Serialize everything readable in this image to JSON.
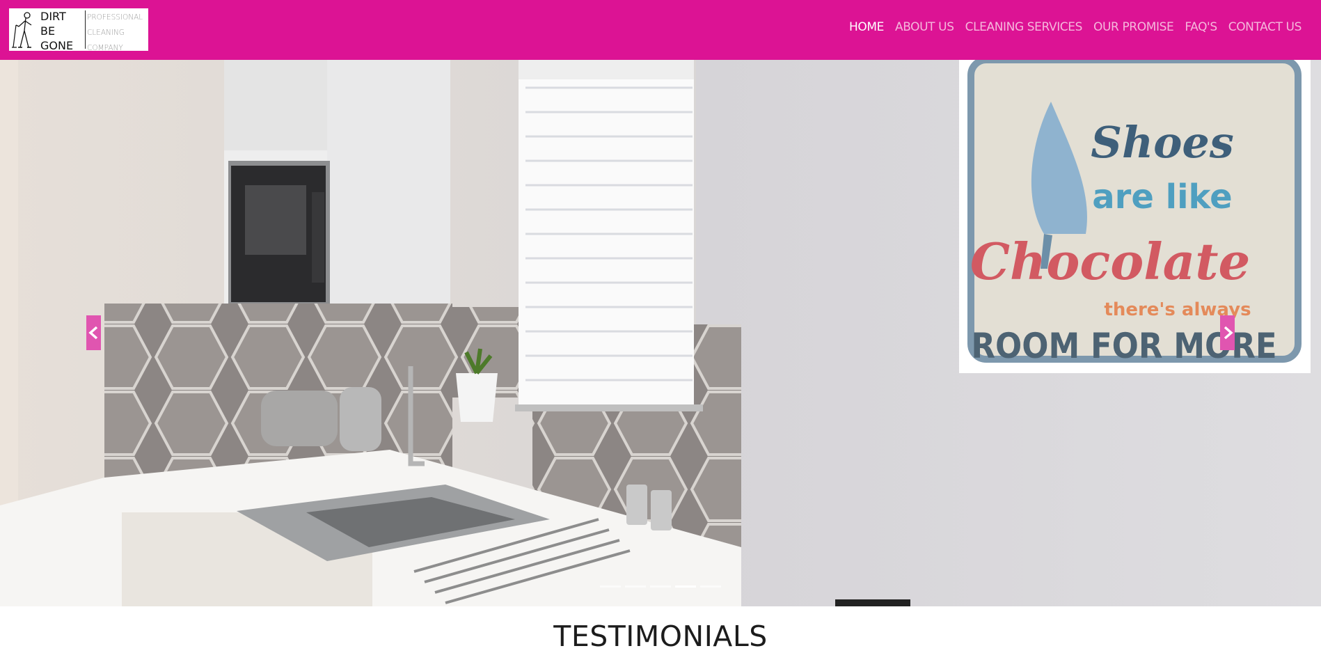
{
  "logo": {
    "main": [
      "DIRT",
      "BE",
      "GONE"
    ],
    "sub": [
      "PROFESSIONAL",
      "CLEANING",
      "COMPANY"
    ]
  },
  "nav": {
    "items": [
      {
        "label": "HOME",
        "active": true
      },
      {
        "label": "ABOUT US"
      },
      {
        "label": "CLEANING SERVICES"
      },
      {
        "label": "OUR PROMISE"
      },
      {
        "label": "FAQ'S"
      },
      {
        "label": "CONTACT US"
      }
    ]
  },
  "hero": {
    "poster": {
      "line1": "Shoes",
      "line2": "are like",
      "line3": "Chocolate",
      "line4": "there's always",
      "line5": "ROOM FOR MORE"
    },
    "slide_count": 5,
    "active_slide": 4
  },
  "testimonials": {
    "title": "TESTIMONIALS"
  },
  "colors": {
    "brand": "#dc1394",
    "carousel_control": "#e055b0"
  }
}
